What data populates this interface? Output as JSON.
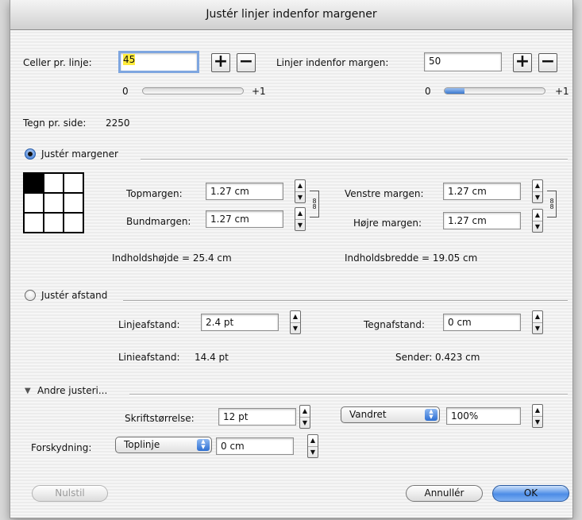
{
  "dialog": {
    "title": "Justér linjer indenfor margener"
  },
  "cells": {
    "label": "Celler pr. linje:",
    "value": "45",
    "plus": "+",
    "minus": "−",
    "slider_min": "0",
    "slider_max": "+1",
    "slider_fraction": 0.0
  },
  "lines": {
    "label": "Linjer indenfor margen:",
    "value": "50",
    "plus": "+",
    "minus": "−",
    "slider_min": "0",
    "slider_max": "+1",
    "slider_fraction": 0.2
  },
  "chars_per_page": {
    "label": "Tegn pr. side:",
    "value": "2250"
  },
  "adjust_margins": {
    "label": "Justér margener",
    "selected": true,
    "top": {
      "label": "Topmargen:",
      "value": "1.27 cm"
    },
    "bottom": {
      "label": "Bundmargen:",
      "value": "1.27 cm"
    },
    "left": {
      "label": "Venstre margen:",
      "value": "1.27 cm"
    },
    "right": {
      "label": "Højre margen:",
      "value": "1.27 cm"
    },
    "content_height": "Indholdshøjde = 25.4 cm",
    "content_width": "Indholdsbredde = 19.05 cm"
  },
  "adjust_spacing": {
    "label": "Justér afstand",
    "selected": false,
    "line_spacing": {
      "label": "Linjeafstand:",
      "value": "2.4 pt"
    },
    "char_spacing": {
      "label": "Tegnafstand:",
      "value": "0 cm"
    },
    "line_distance": {
      "label": "Linieafstand:",
      "value": "14.4 pt"
    },
    "sender": {
      "label": "Sender:",
      "value": "0.423 cm"
    }
  },
  "other": {
    "label": "Andre justeri...",
    "font_size": {
      "label": "Skriftstørrelse:",
      "value": "12 pt"
    },
    "scale_direction": "Vandret",
    "scale_percent": "100%",
    "offset": {
      "label": "Forskydning:",
      "mode": "Toplinje",
      "value": "0 cm"
    }
  },
  "buttons": {
    "reset": "Nulstil",
    "cancel": "Annullér",
    "ok": "OK"
  },
  "colors": {
    "accent": "#3a78cf",
    "highlight": "#ffeb3b"
  }
}
